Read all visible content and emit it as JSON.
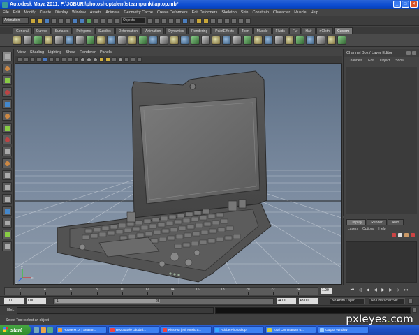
{
  "window": {
    "title": "Autodesk Maya 2011: F:\\JOBURI\\photoshoptalent\\steampunk\\laptop.mb*",
    "buttons": [
      "_",
      "□",
      "×"
    ]
  },
  "menubar": [
    "File",
    "Edit",
    "Modify",
    "Create",
    "Display",
    "Window",
    "Assets",
    "Animate",
    "Geometry Cache",
    "Create Deformers",
    "Edit Deformers",
    "Skeleton",
    "Skin",
    "Constrain",
    "Character",
    "Muscle",
    "Help"
  ],
  "statusline": {
    "mode": "Animation",
    "field": "Objects"
  },
  "shelf": {
    "tabs": [
      "General",
      "Curves",
      "Surfaces",
      "Polygons",
      "Subdivs",
      "Deformation",
      "Animation",
      "Dynamics",
      "Rendering",
      "PaintEffects",
      "Toon",
      "Muscle",
      "Fluids",
      "Fur",
      "Hair",
      "nCloth",
      "Custom"
    ],
    "active_tab": "Custom"
  },
  "panel": {
    "menu": [
      "View",
      "Shading",
      "Lighting",
      "Show",
      "Renderer",
      "Panels"
    ]
  },
  "viewport": {
    "axis_labels": {
      "x": "x",
      "y": "y",
      "z": "z"
    }
  },
  "channel_box": {
    "title": "Channel Box / Layer Editor",
    "menu": [
      "Channels",
      "Edit",
      "Object",
      "Show"
    ]
  },
  "layer_editor": {
    "tabs": [
      "Display",
      "Render",
      "Anim"
    ],
    "active_tab": "Display",
    "menu": [
      "Layers",
      "Options",
      "Help"
    ]
  },
  "timeslider": {
    "ticks": [
      "2",
      "4",
      "6",
      "8",
      "10",
      "12",
      "14",
      "16",
      "18",
      "20",
      "22",
      "24"
    ],
    "current_frame": "1.00"
  },
  "rangeslider": {
    "start_time": "1.00",
    "range_start": "1.00",
    "range_start_marker": "1",
    "range_end_marker": "25",
    "range_end": "24.00",
    "end_time": "48.00",
    "anim_layer": "No Anim Layer",
    "character_set": "No Character Set"
  },
  "commandline": {
    "label": "MEL"
  },
  "helpline": {
    "text": "Select Tool: select an object"
  },
  "taskbar": {
    "start_label": "start",
    "tasks": [
      "House M.D. | Season...",
      "Rezultatele căutării...",
      "Kiss FM | Hit Music S...",
      "Adobe Photoshop",
      "Total Commander 6....",
      "Output Window"
    ]
  },
  "watermark": {
    "text_main": "pxleyes",
    "text_dot": ".",
    "text_tld": "com"
  }
}
